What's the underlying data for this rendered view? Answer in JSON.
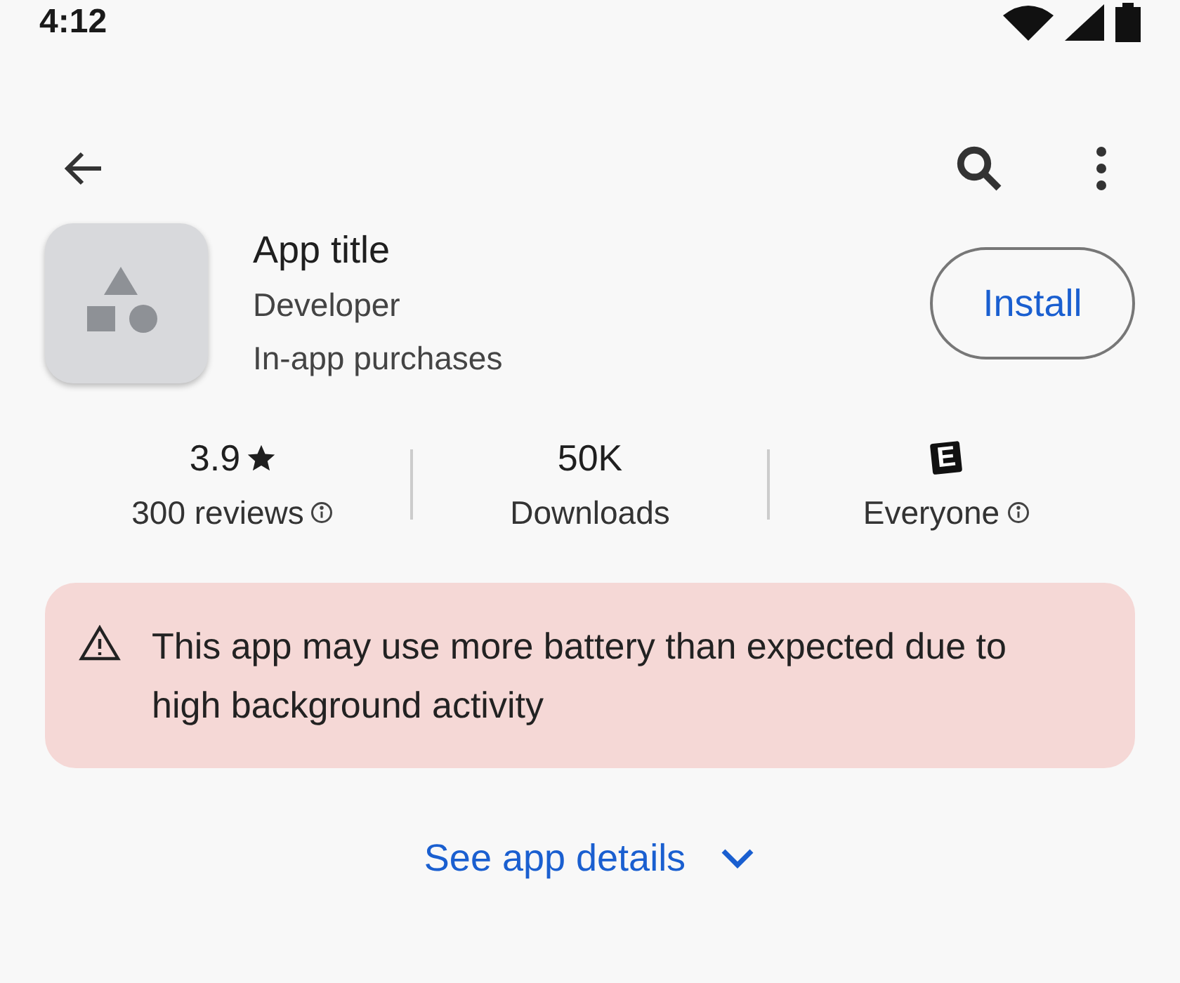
{
  "status_bar": {
    "time": "4:12"
  },
  "app": {
    "title": "App title",
    "developer": "Developer",
    "note": "In-app purchases",
    "install_button": "Install"
  },
  "stats": [
    {
      "kind": "rating",
      "value": "3.9",
      "label": "300 reviews",
      "info": true
    },
    {
      "kind": "count",
      "value": "50K",
      "label": "Downloads",
      "info": false
    },
    {
      "kind": "content_rating",
      "value": "E",
      "label": "Everyone",
      "info": true
    }
  ],
  "warning": {
    "text": "This app may use more battery than expected due to high background activity"
  },
  "details_link": {
    "label": "See app details",
    "expanded": false
  }
}
